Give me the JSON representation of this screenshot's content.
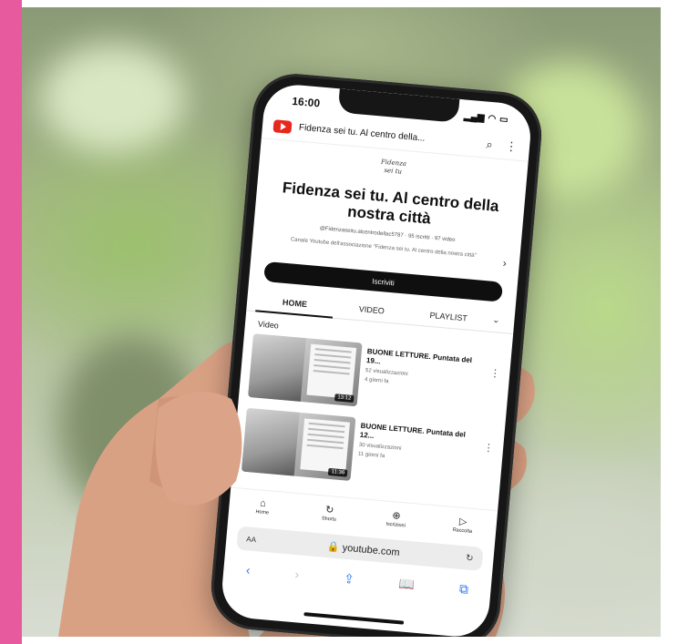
{
  "status_bar": {
    "time": "16:00",
    "signal": "▂▄▆",
    "wifi": "◠",
    "battery": "▭"
  },
  "yt_header": {
    "title": "Fidenza sei tu. Al centro della...",
    "search_icon": "⌕",
    "more_icon": "⋮"
  },
  "channel": {
    "logo_line1": "Fidenza",
    "logo_line2": "sei tu",
    "title": "Fidenza sei tu. Al centro della nostra città",
    "handle": "@Fidenzaseitu.alcentrodellac5787 · 95 iscritti · 97 video",
    "description": "Canale Youtube dell'associazione \"Fidenza sei tu. Al centro della nostra città\"",
    "description_arrow": "›",
    "subscribe_label": "Iscriviti"
  },
  "tabs": [
    {
      "label": "HOME"
    },
    {
      "label": "VIDEO"
    },
    {
      "label": "PLAYLIST"
    }
  ],
  "tabs_more": "⌄",
  "section_label": "Video",
  "videos": [
    {
      "title": "BUONE LETTURE. Puntata del 19...",
      "views": "52 visualizzazioni",
      "age": "4 giorni fa",
      "duration": "13:12",
      "menu": "⋮"
    },
    {
      "title": "BUONE LETTURE. Puntata del 12...",
      "views": "30 visualizzazioni",
      "age": "11 giorni fa",
      "duration": "11:36",
      "menu": "⋮"
    }
  ],
  "bottom_nav": [
    {
      "icon": "⌂",
      "label": "Home"
    },
    {
      "icon": "↻",
      "label": "Shorts"
    },
    {
      "icon": "⊕",
      "label": "Iscrizioni"
    },
    {
      "icon": "▷",
      "label": "Raccolta"
    }
  ],
  "safari": {
    "aa": "AA",
    "url": "🔒 youtube.com",
    "reload": "↻"
  },
  "safari_tools": [
    {
      "icon": "‹"
    },
    {
      "icon": "›"
    },
    {
      "icon": "⇪"
    },
    {
      "icon": "📖"
    },
    {
      "icon": "⧉"
    }
  ],
  "colors": {
    "accent_pink": "#e85a9e",
    "youtube_red": "#e8271d",
    "safari_blue": "#2f7cf6"
  }
}
